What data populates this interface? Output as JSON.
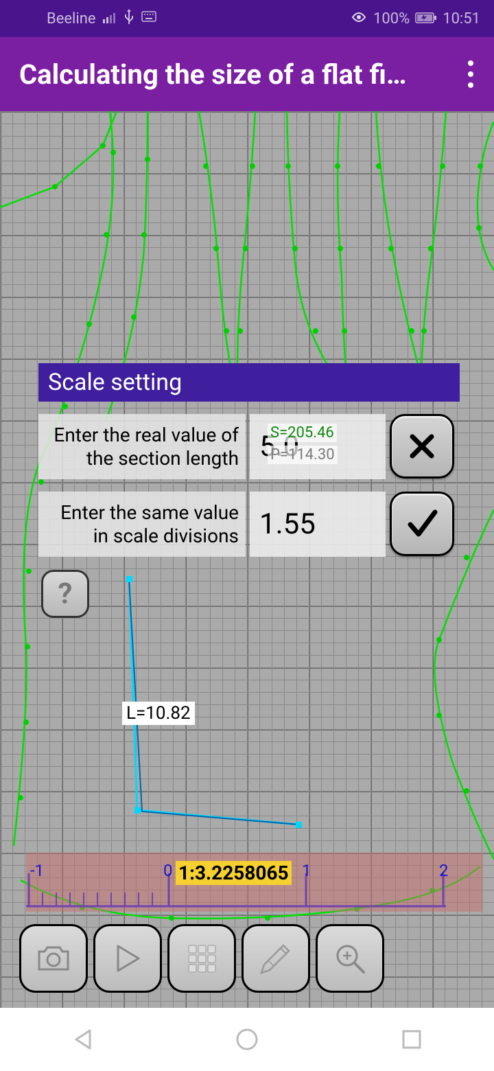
{
  "status": {
    "carrier": "Beeline",
    "battery": "100%",
    "time": "10:51"
  },
  "app": {
    "title": "Calculating the size of a flat fi…"
  },
  "panel": {
    "header": "Scale setting",
    "row1_label": "Enter the real value of the section length",
    "row1_value": "5.0",
    "overlay_s": "S=205.46",
    "overlay_p": "P=114.30",
    "row2_label": "Enter the same value in scale divisions",
    "row2_value": "1.55"
  },
  "measure": {
    "L": "L=10.82"
  },
  "ruler": {
    "scale": "1:3.2258065",
    "t_m1": "-1",
    "t_0": "0",
    "t_1": "1",
    "t_2": "2"
  },
  "help": "?",
  "icons": {
    "cancel": "cancel-icon",
    "confirm": "confirm-icon",
    "camera": "camera-icon",
    "play": "play-icon",
    "grid": "grid-icon",
    "pencil": "pencil-icon",
    "zoom": "zoom-icon"
  }
}
